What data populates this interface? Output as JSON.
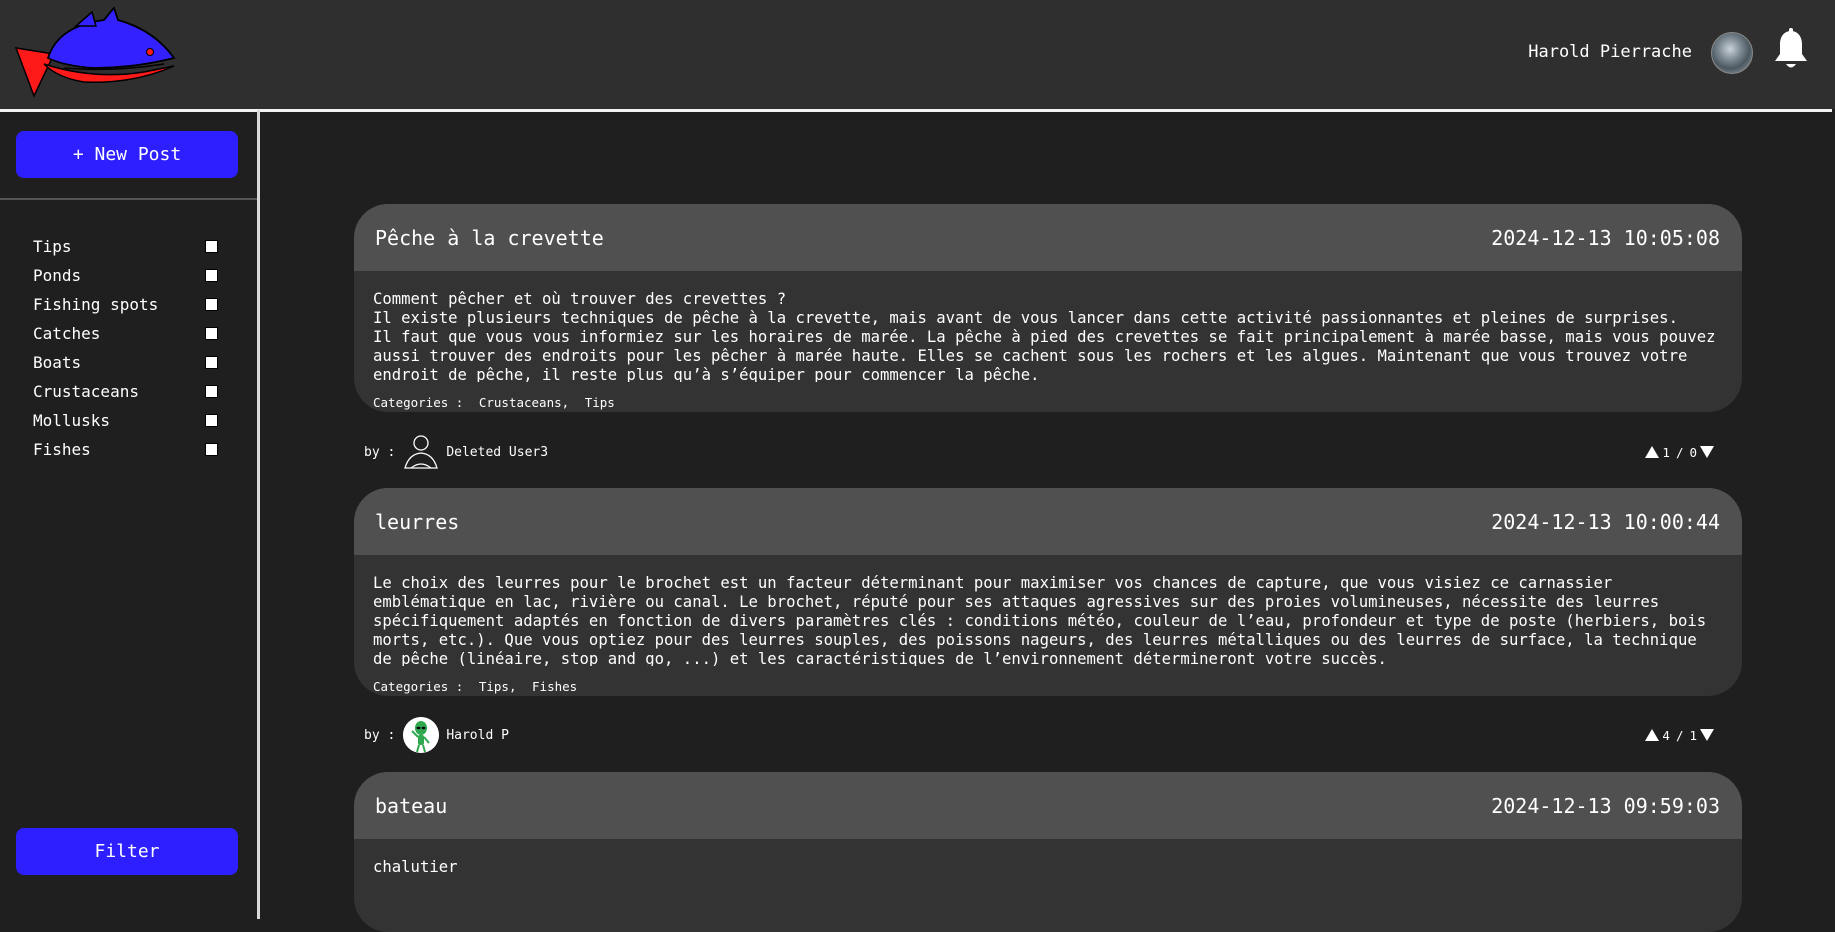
{
  "header": {
    "user_name": "Harold Pierrache"
  },
  "sidebar": {
    "new_post_label": "+ New Post",
    "categories": [
      "Tips",
      "Ponds",
      "Fishing spots",
      "Catches",
      "Boats",
      "Crustaceans",
      "Mollusks",
      "Fishes"
    ],
    "filter_label": "Filter"
  },
  "posts": [
    {
      "title": "Pêche à la crevette",
      "date": "2024-12-13 10:05:08",
      "body": "Comment pêcher et où trouver des crevettes ?\nIl existe plusieurs techniques de pêche à la crevette, mais avant de vous lancer dans cette activité passionnantes et pleines de surprises.\nIl faut que vous vous informiez sur les horaires de marée. La pêche à pied des crevettes se fait principalement à marée basse, mais vous pouvez aussi trouver des endroits pour les pêcher à marée haute. Elles se cachent sous les rochers et les algues. Maintenant que vous trouvez votre endroit de pêche, il reste plus qu’à s’équiper pour commencer la pêche.",
      "categories_label": "Categories :",
      "categories": [
        "Crustaceans,",
        "Tips"
      ],
      "by_label": "by :",
      "author": "Deleted User3",
      "upvotes": "1",
      "vote_sep": "/",
      "downvotes": "0"
    },
    {
      "title": "leurres",
      "date": "2024-12-13 10:00:44",
      "body": "Le choix des leurres pour le brochet est un facteur déterminant pour maximiser vos chances de capture, que vous visiez ce carnassier emblématique en lac, rivière ou canal. Le brochet, réputé pour ses attaques agressives sur des proies volumineuses, nécessite des leurres spécifiquement adaptés en fonction de divers paramètres clés : conditions météo, couleur de l’eau, profondeur et type de poste (herbiers, bois morts, etc.). Que vous optiez pour des leurres souples, des poissons nageurs, des leurres métalliques ou des leurres de surface, la technique de pêche (linéaire, stop and go, ...) et les caractéristiques de l’environnement détermineront votre succès.",
      "categories_label": "Categories :",
      "categories": [
        "Tips,",
        "Fishes"
      ],
      "by_label": "by :",
      "author": "Harold P",
      "upvotes": "4",
      "vote_sep": "/",
      "downvotes": "1"
    },
    {
      "title": "bateau",
      "date": "2024-12-13 09:59:03",
      "body": "chalutier"
    }
  ],
  "colors": {
    "accent": "#2d1fff",
    "background": "#1f1f1f",
    "header_bg": "#2f2f2f",
    "card_bg": "#333333",
    "card_head_bg": "#505050"
  },
  "icons": {
    "logo": "fish-logo-icon",
    "bell": "bell-icon",
    "deleted_user_avatar": "person-outline-icon",
    "harold_avatar": "alien-avatar-icon",
    "upvote": "triangle-up-icon",
    "downvote": "triangle-down-icon"
  }
}
